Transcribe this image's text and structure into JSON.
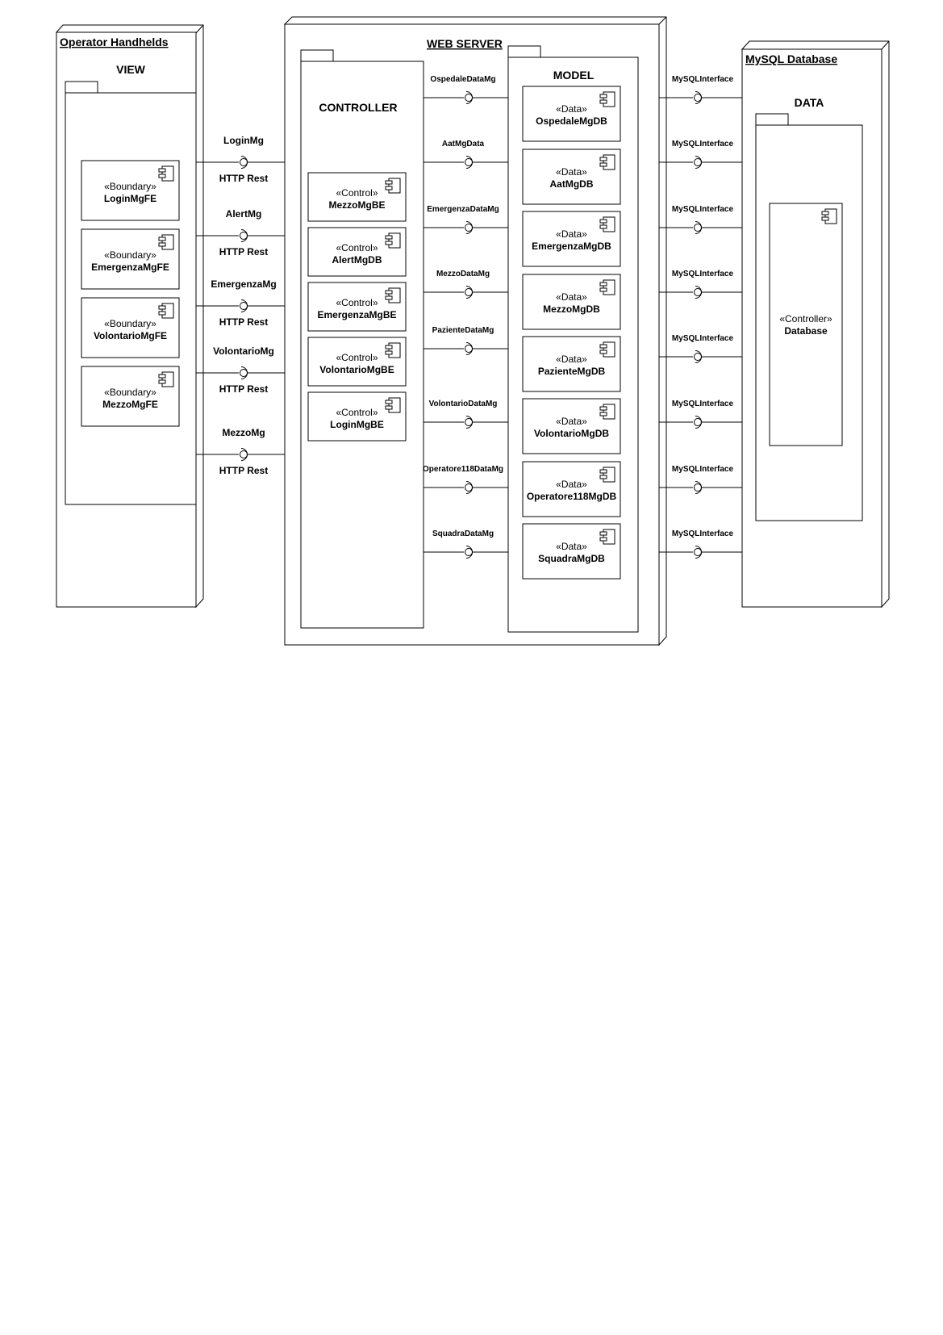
{
  "nodes": {
    "operator": {
      "title": "Operator Handhelds",
      "package": "VIEW"
    },
    "server": {
      "title": "WEB SERVER",
      "controller_package": "CONTROLLER",
      "model_package": "MODEL"
    },
    "mysql": {
      "title": "MySQL Database",
      "package": "DATA"
    }
  },
  "view_components": [
    {
      "stereotype": "«Boundary»",
      "name": "LoginMgFE"
    },
    {
      "stereotype": "«Boundary»",
      "name": "EmergenzaMgFE"
    },
    {
      "stereotype": "«Boundary»",
      "name": "VolontarioMgFE"
    },
    {
      "stereotype": "«Boundary»",
      "name": "MezzoMgFE"
    }
  ],
  "controller_components": [
    {
      "stereotype": "«Control»",
      "name": "MezzoMgBE"
    },
    {
      "stereotype": "«Control»",
      "name": "AlertMgDB"
    },
    {
      "stereotype": "«Control»",
      "name": "EmergenzaMgBE"
    },
    {
      "stereotype": "«Control»",
      "name": "VolontarioMgBE"
    },
    {
      "stereotype": "«Control»",
      "name": "LoginMgBE"
    }
  ],
  "model_components": [
    {
      "stereotype": "«Data»",
      "name": "OspedaleMgDB"
    },
    {
      "stereotype": "«Data»",
      "name": "AatMgDB"
    },
    {
      "stereotype": "«Data»",
      "name": "EmergenzaMgDB"
    },
    {
      "stereotype": "«Data»",
      "name": "MezzoMgDB"
    },
    {
      "stereotype": "«Data»",
      "name": "PazienteMgDB"
    },
    {
      "stereotype": "«Data»",
      "name": "VolontarioMgDB"
    },
    {
      "stereotype": "«Data»",
      "name": "Operatore118MgDB"
    },
    {
      "stereotype": "«Data»",
      "name": "SquadraMgDB"
    }
  ],
  "database_component": {
    "stereotype": "«Controller»",
    "name": "Database"
  },
  "client_interfaces": [
    {
      "name": "LoginMg",
      "protocol": "HTTP Rest"
    },
    {
      "name": "AlertMg",
      "protocol": "HTTP Rest"
    },
    {
      "name": "EmergenzaMg",
      "protocol": "HTTP Rest"
    },
    {
      "name": "VolontarioMg",
      "protocol": "HTTP Rest"
    },
    {
      "name": "MezzoMg",
      "protocol": "HTTP Rest"
    }
  ],
  "data_interfaces": [
    "OspedaleDataMg",
    "AatMgData",
    "EmergenzaDataMg",
    "MezzoDataMg",
    "PazienteDataMg",
    "VolontarioDataMg",
    "Operatore118DataMg",
    "SquadraDataMg"
  ],
  "db_interfaces": [
    "MySQLInterface",
    "MySQLInterface",
    "MySQLInterface",
    "MySQLInterface",
    "MySQLInterface",
    "MySQLInterface",
    "MySQLInterface",
    "MySQLInterface"
  ]
}
